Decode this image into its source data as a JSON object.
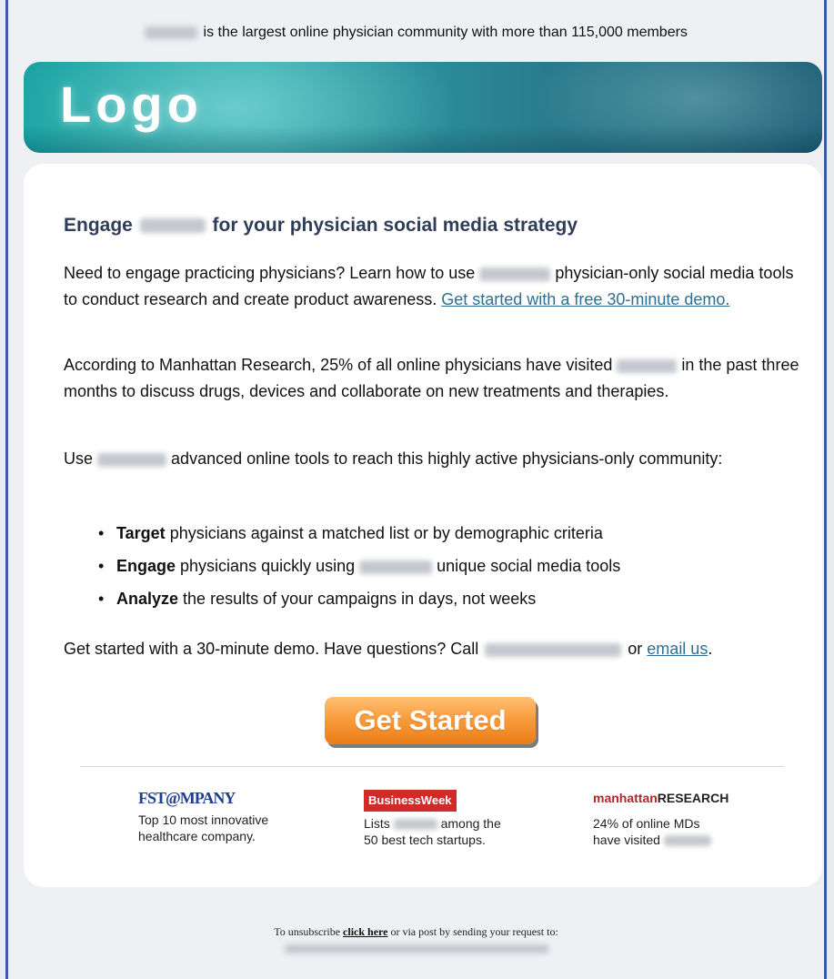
{
  "top_bar": {
    "text": "is the largest online physician community with more than 115,000 members"
  },
  "banner": {
    "logo_text": "Logo"
  },
  "main": {
    "headline_start": "Engage",
    "headline_end": "for your physician social media strategy",
    "p1_a": "Need to engage practicing physicians? Learn how to use",
    "p1_b": "physician-only social media tools to conduct research and create product awareness.",
    "p1_link": "Get started with a free 30-minute demo.",
    "p2_a": "According to Manhattan Research, 25% of all online physicians have visited",
    "p2_b": "in the past three months to discuss drugs, devices and collaborate on new treatments and therapies.",
    "p3_a": "Use",
    "p3_b": "advanced online tools to reach this highly active physicians-only community:",
    "bullets": [
      {
        "bold": "Target",
        "text": "physicians against a matched list or by demographic criteria"
      },
      {
        "bold": "Engage",
        "text_a": "physicians quickly using",
        "text_b": "unique social media tools"
      },
      {
        "bold": "Analyze",
        "text": "the results of your campaigns in days, not weeks"
      }
    ],
    "cta_text_a": "Get started with a 30-minute demo. Have questions? Call",
    "cta_text_b": "or",
    "cta_link": "email us",
    "cta_period": ".",
    "button_label": "Get Started"
  },
  "press": [
    {
      "logo": "FST@MPANY",
      "line1": "Top 10 most innovative",
      "line2": "healthcare company."
    },
    {
      "logo": "BusinessWeek",
      "line1_a": "Lists",
      "line1_b": "among the",
      "line2": "50 best tech startups."
    },
    {
      "logo_a": "manhattan",
      "logo_b": "RESEARCH",
      "line1": "24% of online MDs",
      "line2": "have visited"
    }
  ],
  "footer": {
    "text_a": "To unsubscribe",
    "link": "click here",
    "text_b": "or via post by sending your request to:"
  },
  "colors": {
    "frame": "#3e5aa6",
    "headline": "#2e3d58",
    "link": "#2e6f92",
    "button": "#f89b3b",
    "banner": "#29a9ad"
  }
}
